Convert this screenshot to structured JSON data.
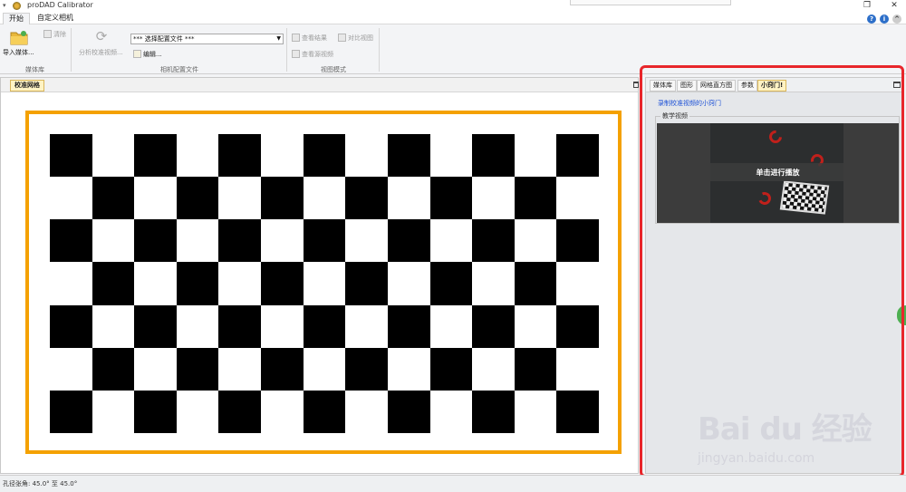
{
  "window": {
    "title": "proDAD Calibrator",
    "controls": {
      "restore": "❐",
      "close": "✕"
    }
  },
  "tabs": [
    {
      "label": "开始",
      "active": true
    },
    {
      "label": "自定义相机",
      "active": false
    }
  ],
  "ribbon": {
    "import_media": "导入媒体...",
    "clear": "清除",
    "analyze": "分析校准视频...",
    "config_select": "*** 选择配置文件 ***",
    "edit": "编辑...",
    "view_result": "查看结果",
    "compare_view": "对比视图",
    "view_source": "查看源视频",
    "groups": {
      "media": "媒体库",
      "camera_config": "相机配置文件",
      "view_mode": "视图模式"
    }
  },
  "left_panel": {
    "tab_label": "校准网格"
  },
  "right_panel": {
    "tabs": [
      {
        "label": "媒体库",
        "active": false
      },
      {
        "label": "图形",
        "active": false
      },
      {
        "label": "网格直方图",
        "active": false
      },
      {
        "label": "参数",
        "active": false
      },
      {
        "label": "小窍门!",
        "active": true
      }
    ],
    "link": "录制校准视频的小窍门",
    "video_group_label": "教学视频",
    "play_label": "单击进行播放"
  },
  "status": {
    "text": "孔径张角: 45.0° 至 45.0°"
  },
  "watermark": {
    "brand": "Bai du 经验",
    "url": "jingyan.baidu.com"
  },
  "colors": {
    "board_frame": "#f4a100",
    "annotation": "#e8262b",
    "active_tab": "#fff3c4",
    "link": "#1a4fd6"
  },
  "checkerboard": {
    "rows": 7,
    "cols": 13
  }
}
